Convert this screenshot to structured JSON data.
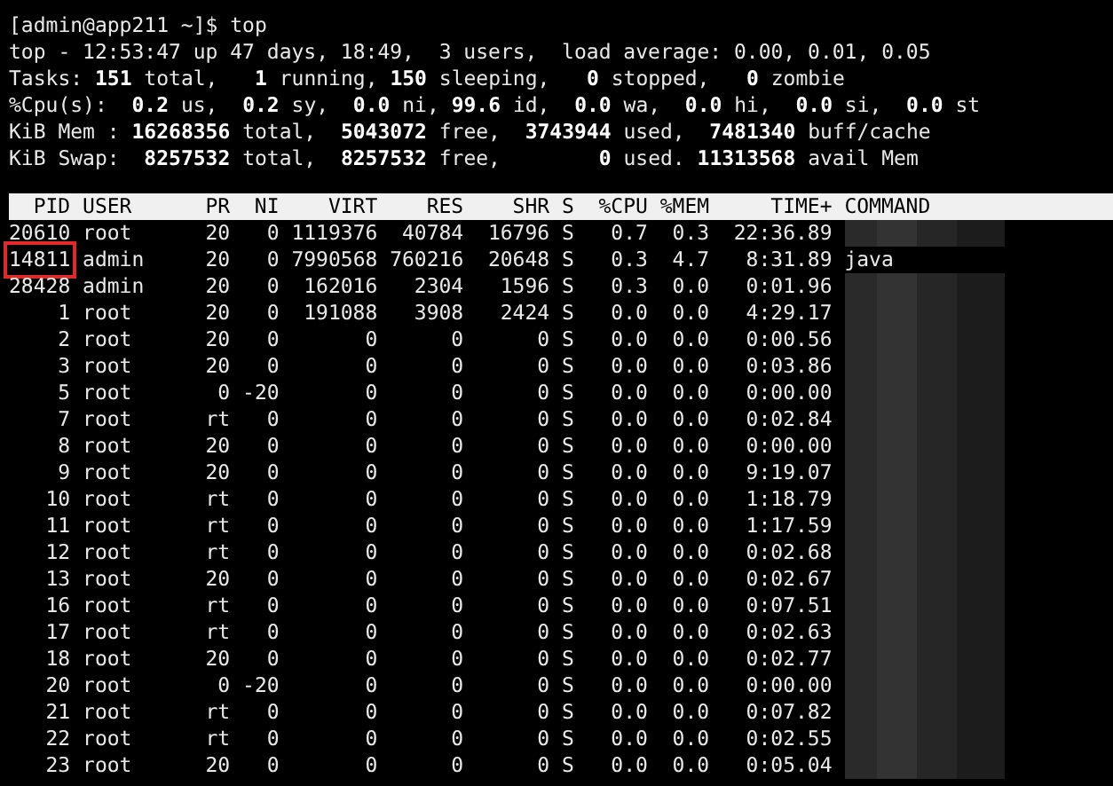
{
  "prompt": "[admin@app211 ~]$ top",
  "summary": [
    "top - 12:53:47 up 47 days, 18:49,  3 users,  load average: 0.00, 0.01, 0.05",
    "Tasks: **151** total,   **1** running, **150** sleeping,   **0** stopped,   **0** zombie",
    "%Cpu(s):  **0.2** us,  **0.2** sy,  **0.0** ni, **99.6** id,  **0.0** wa,  **0.0** hi,  **0.0** si,  **0.0** st",
    "KiB Mem : **16268356** total,  **5043072** free,  **3743944** used,  **7481340** buff/cache",
    "KiB Swap:  **8257532** total,  **8257532** free,        **0** used. **11313568** avail Mem"
  ],
  "table": {
    "columns": [
      "PID",
      "USER",
      "PR",
      "NI",
      "VIRT",
      "RES",
      "SHR",
      "S",
      "%CPU",
      "%MEM",
      "TIME+",
      "COMMAND"
    ],
    "rows": [
      {
        "cells": [
          "20610",
          "root",
          "20",
          "0",
          "1119376",
          "40784",
          "16796",
          "S",
          "0.7",
          "0.3",
          "22:36.89"
        ],
        "command_hidden": true,
        "highlighted": false
      },
      {
        "cells": [
          "14811",
          "admin",
          "20",
          "0",
          "7990568",
          "760216",
          "20648",
          "S",
          "0.3",
          "4.7",
          "8:31.89",
          "java"
        ],
        "command_hidden": false,
        "highlighted": true
      },
      {
        "cells": [
          "28428",
          "admin",
          "20",
          "0",
          "162016",
          "2304",
          "1596",
          "S",
          "0.3",
          "0.0",
          "0:01.96"
        ],
        "command_hidden": true,
        "highlighted": false
      },
      {
        "cells": [
          "1",
          "root",
          "20",
          "0",
          "191088",
          "3908",
          "2424",
          "S",
          "0.0",
          "0.0",
          "4:29.17"
        ],
        "command_hidden": true,
        "highlighted": false
      },
      {
        "cells": [
          "2",
          "root",
          "20",
          "0",
          "0",
          "0",
          "0",
          "S",
          "0.0",
          "0.0",
          "0:00.56"
        ],
        "command_hidden": true,
        "highlighted": false
      },
      {
        "cells": [
          "3",
          "root",
          "20",
          "0",
          "0",
          "0",
          "0",
          "S",
          "0.0",
          "0.0",
          "0:03.86"
        ],
        "command_hidden": true,
        "highlighted": false
      },
      {
        "cells": [
          "5",
          "root",
          "0",
          "-20",
          "0",
          "0",
          "0",
          "S",
          "0.0",
          "0.0",
          "0:00.00"
        ],
        "command_hidden": true,
        "highlighted": false
      },
      {
        "cells": [
          "7",
          "root",
          "rt",
          "0",
          "0",
          "0",
          "0",
          "S",
          "0.0",
          "0.0",
          "0:02.84"
        ],
        "command_hidden": true,
        "highlighted": false
      },
      {
        "cells": [
          "8",
          "root",
          "20",
          "0",
          "0",
          "0",
          "0",
          "S",
          "0.0",
          "0.0",
          "0:00.00"
        ],
        "command_hidden": true,
        "highlighted": false
      },
      {
        "cells": [
          "9",
          "root",
          "20",
          "0",
          "0",
          "0",
          "0",
          "S",
          "0.0",
          "0.0",
          "9:19.07"
        ],
        "command_hidden": true,
        "highlighted": false
      },
      {
        "cells": [
          "10",
          "root",
          "rt",
          "0",
          "0",
          "0",
          "0",
          "S",
          "0.0",
          "0.0",
          "1:18.79"
        ],
        "command_hidden": true,
        "highlighted": false
      },
      {
        "cells": [
          "11",
          "root",
          "rt",
          "0",
          "0",
          "0",
          "0",
          "S",
          "0.0",
          "0.0",
          "1:17.59"
        ],
        "command_hidden": true,
        "highlighted": false
      },
      {
        "cells": [
          "12",
          "root",
          "rt",
          "0",
          "0",
          "0",
          "0",
          "S",
          "0.0",
          "0.0",
          "0:02.68"
        ],
        "command_hidden": true,
        "highlighted": false
      },
      {
        "cells": [
          "13",
          "root",
          "20",
          "0",
          "0",
          "0",
          "0",
          "S",
          "0.0",
          "0.0",
          "0:02.67"
        ],
        "command_hidden": true,
        "highlighted": false
      },
      {
        "cells": [
          "16",
          "root",
          "rt",
          "0",
          "0",
          "0",
          "0",
          "S",
          "0.0",
          "0.0",
          "0:07.51"
        ],
        "command_hidden": true,
        "highlighted": false
      },
      {
        "cells": [
          "17",
          "root",
          "rt",
          "0",
          "0",
          "0",
          "0",
          "S",
          "0.0",
          "0.0",
          "0:02.63"
        ],
        "command_hidden": true,
        "highlighted": false
      },
      {
        "cells": [
          "18",
          "root",
          "20",
          "0",
          "0",
          "0",
          "0",
          "S",
          "0.0",
          "0.0",
          "0:02.77"
        ],
        "command_hidden": true,
        "highlighted": false
      },
      {
        "cells": [
          "20",
          "root",
          "0",
          "-20",
          "0",
          "0",
          "0",
          "S",
          "0.0",
          "0.0",
          "0:00.00"
        ],
        "command_hidden": true,
        "highlighted": false
      },
      {
        "cells": [
          "21",
          "root",
          "rt",
          "0",
          "0",
          "0",
          "0",
          "S",
          "0.0",
          "0.0",
          "0:07.82"
        ],
        "command_hidden": true,
        "highlighted": false
      },
      {
        "cells": [
          "22",
          "root",
          "rt",
          "0",
          "0",
          "0",
          "0",
          "S",
          "0.0",
          "0.0",
          "0:02.55"
        ],
        "command_hidden": true,
        "highlighted": false
      },
      {
        "cells": [
          "23",
          "root",
          "20",
          "0",
          "0",
          "0",
          "0",
          "S",
          "0.0",
          "0.0",
          "0:05.04"
        ],
        "command_hidden": true,
        "highlighted": false
      }
    ]
  }
}
